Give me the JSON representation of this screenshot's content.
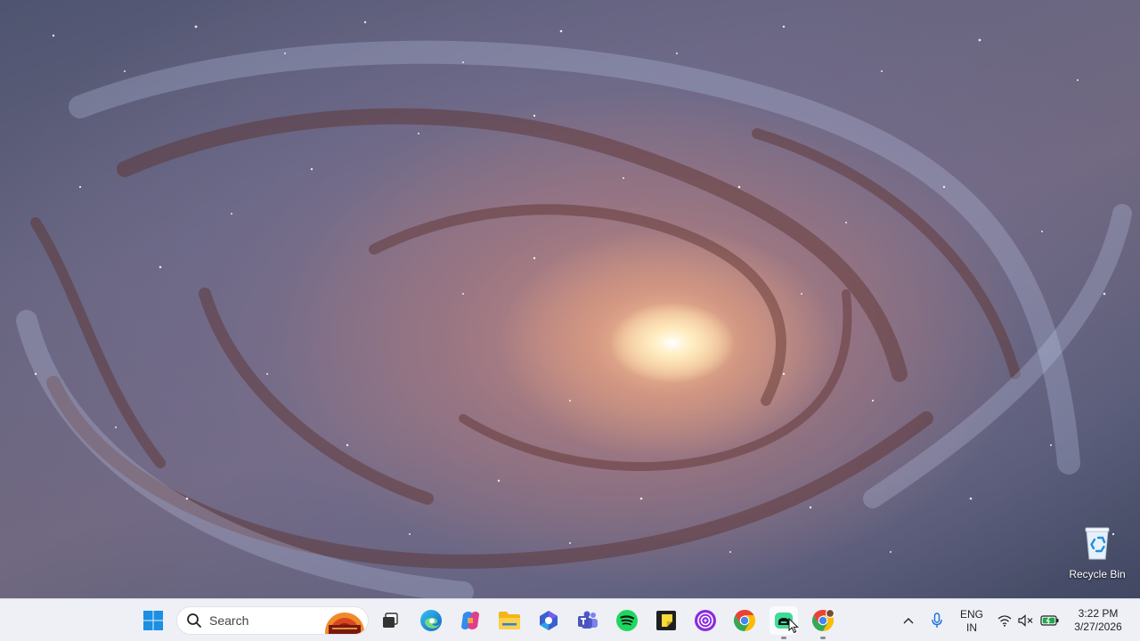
{
  "desktop": {
    "icons": [
      {
        "label": "Recycle Bin",
        "icon": "recycle-bin-icon"
      }
    ]
  },
  "taskbar": {
    "start_icon": "windows-start-icon",
    "search": {
      "placeholder": "Search",
      "icon": "search-icon"
    },
    "apps": [
      {
        "name": "task-view",
        "icon": "task-view-icon",
        "running": false,
        "active": false
      },
      {
        "name": "edge",
        "icon": "edge-icon",
        "running": false,
        "active": false
      },
      {
        "name": "copilot",
        "icon": "copilot-icon",
        "running": false,
        "active": false
      },
      {
        "name": "file-explorer",
        "icon": "folder-icon",
        "running": false,
        "active": false
      },
      {
        "name": "microsoft-365",
        "icon": "m365-icon",
        "running": false,
        "active": false
      },
      {
        "name": "teams",
        "icon": "teams-icon",
        "running": false,
        "active": false
      },
      {
        "name": "spotify",
        "icon": "spotify-icon",
        "running": false,
        "active": false
      },
      {
        "name": "sticky-notes",
        "icon": "sticky-notes-icon",
        "running": false,
        "active": false
      },
      {
        "name": "purple-app",
        "icon": "purple-circle-app-icon",
        "running": false,
        "active": false
      },
      {
        "name": "chrome",
        "icon": "chrome-icon",
        "running": false,
        "active": false
      },
      {
        "name": "gaming-app",
        "icon": "gaming-app-icon",
        "running": true,
        "active": true
      },
      {
        "name": "chrome-profile",
        "icon": "chrome-profile-icon",
        "running": true,
        "active": false
      }
    ],
    "tray": {
      "overflow_icon": "chevron-up-icon",
      "mic_icon": "microphone-icon",
      "language": {
        "line1": "ENG",
        "line2": "IN"
      },
      "wifi_icon": "wifi-icon",
      "volume_icon": "volume-muted-icon",
      "battery_icon": "battery-charging-icon",
      "time": "3:22 PM",
      "date": "3/27/2026"
    }
  }
}
